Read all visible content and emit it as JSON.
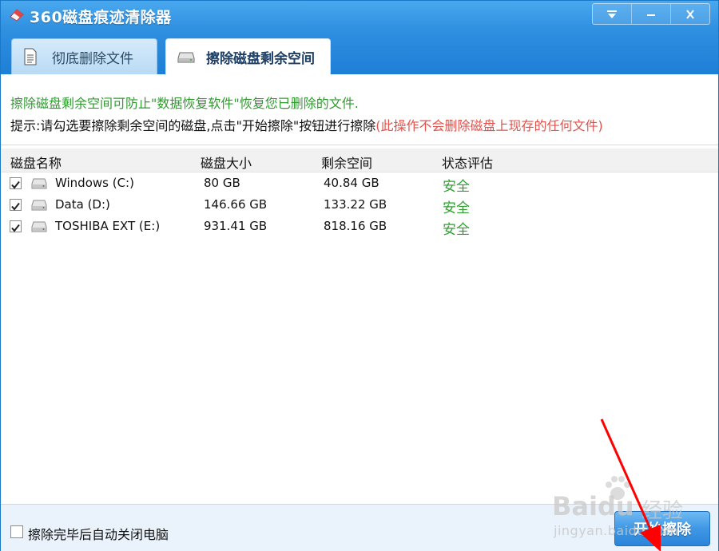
{
  "app": {
    "title": "360磁盘痕迹清除器"
  },
  "tabs": [
    {
      "label": "彻底删除文件",
      "active": false
    },
    {
      "label": "擦除磁盘剩余空间",
      "active": true
    }
  ],
  "hints": {
    "line1": "擦除磁盘剩余空间可防止\"数据恢复软件\"恢复您已删除的文件.",
    "line2_main": "提示:请勾选要擦除剩余空间的磁盘,点击\"开始擦除\"按钮进行擦除",
    "line2_warning": "(此操作不会删除磁盘上现存的任何文件)"
  },
  "columns": {
    "name": "磁盘名称",
    "size": "磁盘大小",
    "free": "剩余空间",
    "status": "状态评估"
  },
  "disks": [
    {
      "name": "Windows (C:)",
      "size": "80 GB",
      "free": "40.84 GB",
      "status": "安全",
      "checked": true
    },
    {
      "name": "Data (D:)",
      "size": "146.66 GB",
      "free": "133.22 GB",
      "status": "安全",
      "checked": true
    },
    {
      "name": "TOSHIBA EXT (E:)",
      "size": "931.41 GB",
      "free": "818.16 GB",
      "status": "安全",
      "checked": true
    }
  ],
  "footer": {
    "auto_shutdown_label": "擦除完毕后自动关闭电脑",
    "auto_shutdown_checked": false,
    "start_label": "开始擦除"
  },
  "watermark": {
    "brand": "Baidu",
    "brand_cn": "经验",
    "url": "jingyan.baidu.com"
  },
  "colors": {
    "accent": "#2f8fe0",
    "safe": "#2fa02f",
    "warning": "#e0524c",
    "hint": "#2f9b2f",
    "annotation": "#ff0000"
  },
  "icons": {
    "app": "eraser-icon",
    "menu": "dropdown-menu-icon",
    "minimize": "minimize-icon",
    "close": "close-icon",
    "tab1": "document-icon",
    "tab2": "hard-drive-icon",
    "drive": "hard-drive-icon",
    "check": "checkmark-icon"
  }
}
